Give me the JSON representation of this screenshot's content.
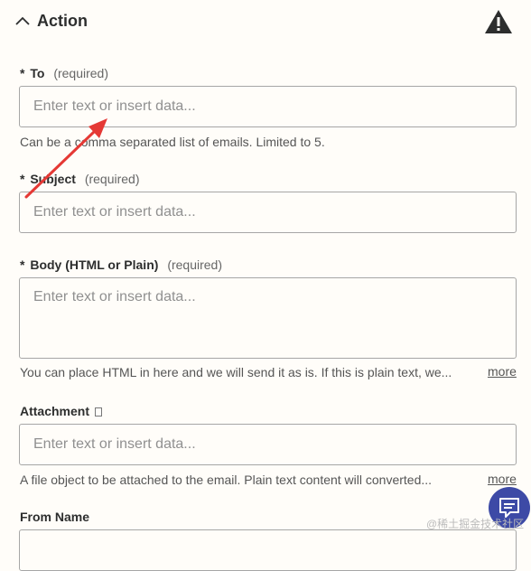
{
  "header": {
    "title": "Action",
    "warning_icon": "warning-triangle-icon",
    "collapse_icon": "chevron-up-icon"
  },
  "fields": {
    "to": {
      "label": "To",
      "required": "(required)",
      "placeholder": "Enter text or insert data...",
      "help": "Can be a comma separated list of emails. Limited to 5."
    },
    "subject": {
      "label": "Subject",
      "required": "(required)",
      "placeholder": "Enter text or insert data..."
    },
    "body": {
      "label": "Body (HTML or Plain)",
      "required": "(required)",
      "placeholder": "Enter text or insert data...",
      "help": "You can place HTML in here and we will send it as is. If this is plain text, we...",
      "more": "more"
    },
    "attachment": {
      "label": "Attachment",
      "icon": "document-icon",
      "placeholder": "Enter text or insert data...",
      "help": "A file object to be attached to the email. Plain text content will converted...",
      "more": "more"
    },
    "from_name": {
      "label": "From Name"
    }
  },
  "required_marker": "*",
  "watermark": "@稀土掘金技术社区",
  "colors": {
    "accent": "#3d4aa6",
    "annotation": "#e53935",
    "background": "#fffdf9"
  }
}
